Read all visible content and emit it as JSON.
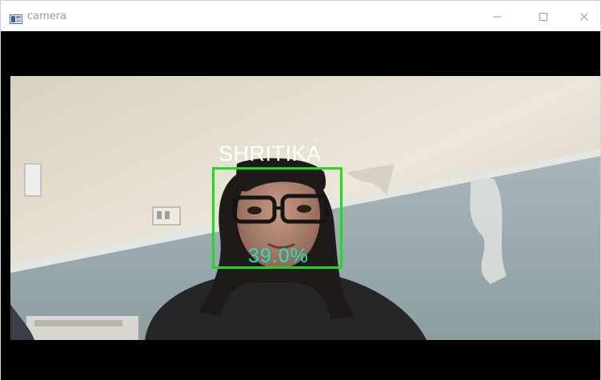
{
  "window": {
    "title": "camera",
    "controls": {
      "minimize_icon": "minimize-icon",
      "maximize_icon": "maximize-icon",
      "close_icon": "close-icon"
    }
  },
  "detection": {
    "name": "SHRITIKA",
    "confidence": "39.0%",
    "box_color": "#1cdd1a",
    "name_color": "#ffffff",
    "confidence_color": "#17e8c5"
  }
}
